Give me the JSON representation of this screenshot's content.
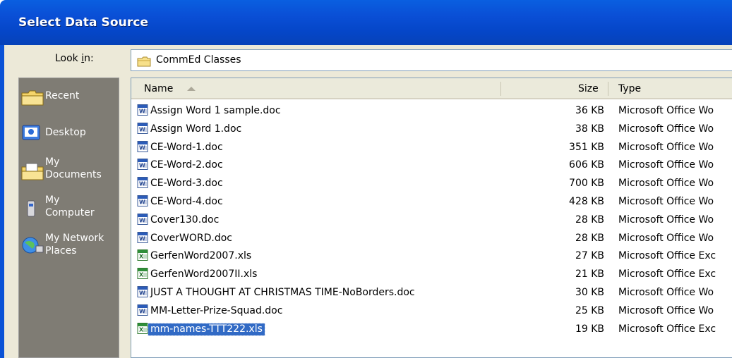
{
  "window": {
    "title": "Select Data Source"
  },
  "lookin": {
    "label_prefix": "Look ",
    "label_accel": "i",
    "label_suffix": "n:",
    "value": "CommEd Classes"
  },
  "places": [
    {
      "label": "Recent",
      "icon": "recent-folder-icon"
    },
    {
      "label": "Desktop",
      "icon": "desktop-icon"
    },
    {
      "label": "My Documents",
      "icon": "my-documents-icon"
    },
    {
      "label": "My Computer",
      "icon": "my-computer-icon"
    },
    {
      "label": "My Network Places",
      "icon": "network-places-icon"
    }
  ],
  "columns": {
    "name": "Name",
    "size": "Size",
    "type": "Type"
  },
  "files": [
    {
      "name": "Assign Word 1 sample.doc",
      "size": "36 KB",
      "type": "Microsoft Office Wo",
      "kind": "word"
    },
    {
      "name": "Assign Word 1.doc",
      "size": "38 KB",
      "type": "Microsoft Office Wo",
      "kind": "word"
    },
    {
      "name": "CE-Word-1.doc",
      "size": "351 KB",
      "type": "Microsoft Office Wo",
      "kind": "word"
    },
    {
      "name": "CE-Word-2.doc",
      "size": "606 KB",
      "type": "Microsoft Office Wo",
      "kind": "word"
    },
    {
      "name": "CE-Word-3.doc",
      "size": "700 KB",
      "type": "Microsoft Office Wo",
      "kind": "word"
    },
    {
      "name": "CE-Word-4.doc",
      "size": "428 KB",
      "type": "Microsoft Office Wo",
      "kind": "word"
    },
    {
      "name": "Cover130.doc",
      "size": "28 KB",
      "type": "Microsoft Office Wo",
      "kind": "word"
    },
    {
      "name": "CoverWORD.doc",
      "size": "28 KB",
      "type": "Microsoft Office Wo",
      "kind": "word"
    },
    {
      "name": "GerfenWord2007.xls",
      "size": "27 KB",
      "type": "Microsoft Office Exc",
      "kind": "excel"
    },
    {
      "name": "GerfenWord2007II.xls",
      "size": "21 KB",
      "type": "Microsoft Office Exc",
      "kind": "excel"
    },
    {
      "name": "JUST A THOUGHT AT CHRISTMAS TIME-NoBorders.doc",
      "size": "30 KB",
      "type": "Microsoft Office Wo",
      "kind": "word"
    },
    {
      "name": "MM-Letter-Prize-Squad.doc",
      "size": "25 KB",
      "type": "Microsoft Office Wo",
      "kind": "word"
    },
    {
      "name": "mm-names-TTT222.xls",
      "size": "19 KB",
      "type": "Microsoft Office Exc",
      "kind": "excel",
      "selected": true
    }
  ],
  "colors": {
    "title_bar": "#0a4fd6",
    "selection": "#316ac5",
    "places_bar": "#7f7c74",
    "dialog_bg": "#ece9d8"
  }
}
